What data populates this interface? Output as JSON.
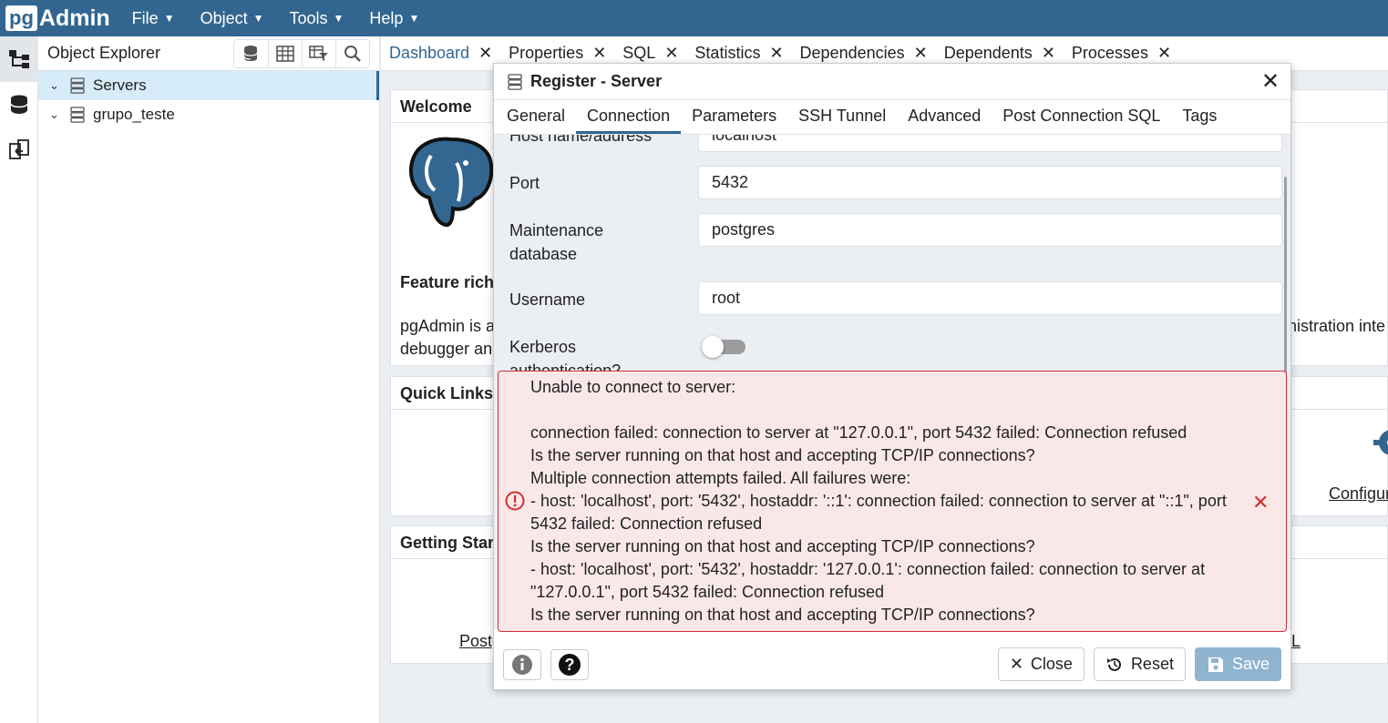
{
  "app": {
    "logo_pg": "pg",
    "logo_admin": "Admin"
  },
  "menu": [
    {
      "label": "File"
    },
    {
      "label": "Object"
    },
    {
      "label": "Tools"
    },
    {
      "label": "Help"
    }
  ],
  "explorer": {
    "title": "Object Explorer",
    "tree": [
      {
        "label": "Servers"
      },
      {
        "label": "grupo_teste"
      }
    ]
  },
  "main_tabs": [
    {
      "label": "Dashboard"
    },
    {
      "label": "Properties"
    },
    {
      "label": "SQL"
    },
    {
      "label": "Statistics"
    },
    {
      "label": "Dependencies"
    },
    {
      "label": "Dependents"
    },
    {
      "label": "Processes"
    }
  ],
  "dashboard": {
    "welcome_title": "Welcome",
    "feature_text": "Feature rich",
    "intro_line1_start": "pgAdmin is a",
    "intro_line1_end": "nistration inte",
    "intro_line2": "debugger and",
    "quick_links_title": "Quick Links",
    "configure_label": "Configur",
    "getting_started_title": "Getting Star",
    "postgres_link": "Postg",
    "right_link": "L"
  },
  "dialog": {
    "title": "Register - Server",
    "tabs": [
      {
        "label": "General"
      },
      {
        "label": "Connection"
      },
      {
        "label": "Parameters"
      },
      {
        "label": "SSH Tunnel"
      },
      {
        "label": "Advanced"
      },
      {
        "label": "Post Connection SQL"
      },
      {
        "label": "Tags"
      }
    ],
    "fields": {
      "host_label": "Host name/address",
      "host_value": "localhost",
      "port_label": "Port",
      "port_value": "5432",
      "maint_label_1": "Maintenance",
      "maint_label_2": "database",
      "maint_value": "postgres",
      "username_label": "Username",
      "username_value": "root",
      "kerberos_label_1": "Kerberos",
      "kerberos_label_2": "authentication?"
    },
    "error_lines": [
      "Unable to connect to server:",
      "",
      "connection failed: connection to server at \"127.0.0.1\", port 5432 failed: Connection refused",
      "Is the server running on that host and accepting TCP/IP connections?",
      "Multiple connection attempts failed. All failures were:",
      "- host: 'localhost', port: '5432', hostaddr: '::1': connection failed: connection to server at \"::1\", port",
      "5432 failed: Connection refused",
      "Is the server running on that host and accepting TCP/IP connections?",
      "- host: 'localhost', port: '5432', hostaddr: '127.0.0.1': connection failed: connection to server at",
      "\"127.0.0.1\", port 5432 failed: Connection refused",
      "Is the server running on that host and accepting TCP/IP connections?"
    ],
    "buttons": {
      "close": "Close",
      "reset": "Reset",
      "save": "Save"
    }
  },
  "colors": {
    "brand": "#326690",
    "error_border": "#d32e2e",
    "error_bg": "#fae8e9"
  }
}
